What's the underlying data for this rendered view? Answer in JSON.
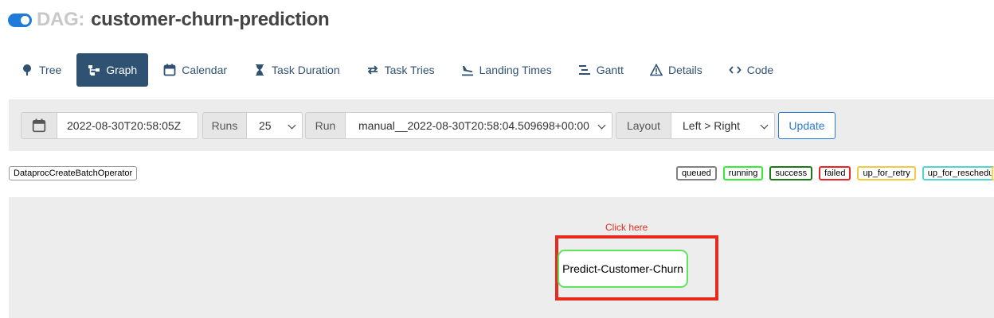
{
  "header": {
    "prefix": "DAG:",
    "dag_id": "customer-churn-prediction",
    "toggle_state": "on"
  },
  "tabs": [
    {
      "label": "Tree",
      "icon": "tree-icon",
      "active": false
    },
    {
      "label": "Graph",
      "icon": "graph-icon",
      "active": true
    },
    {
      "label": "Calendar",
      "icon": "calendar-icon",
      "active": false
    },
    {
      "label": "Task Duration",
      "icon": "hourglass-icon",
      "active": false
    },
    {
      "label": "Task Tries",
      "icon": "retry-icon",
      "active": false
    },
    {
      "label": "Landing Times",
      "icon": "plane-landing-icon",
      "active": false
    },
    {
      "label": "Gantt",
      "icon": "gantt-icon",
      "active": false
    },
    {
      "label": "Details",
      "icon": "warning-triangle-icon",
      "active": false
    },
    {
      "label": "Code",
      "icon": "code-icon",
      "active": false
    }
  ],
  "toolbar": {
    "date_value": "2022-08-30T20:58:05Z",
    "runs_label": "Runs",
    "runs_value": "25",
    "run_label": "Run",
    "run_value": "manual__2022-08-30T20:58:04.509698+00:00",
    "layout_label": "Layout",
    "layout_value": "Left > Right",
    "update_label": "Update"
  },
  "operator_tag": "DataprocCreateBatchOperator",
  "legend": [
    {
      "label": "queued",
      "color": "#808080"
    },
    {
      "label": "running",
      "color": "#00ff00"
    },
    {
      "label": "success",
      "color": "#008000"
    },
    {
      "label": "failed",
      "color": "#ff0000"
    },
    {
      "label": "up_for_retry",
      "color": "#ffd700"
    },
    {
      "label": "up_for_reschedule",
      "color": "#40e0d0"
    }
  ],
  "graph": {
    "annotation": "Click here",
    "annotation_color": "#e03020",
    "highlight_color": "#e8291e",
    "task_label": "Predict-Customer-Churn",
    "task_state_color": "#5ce65c"
  }
}
